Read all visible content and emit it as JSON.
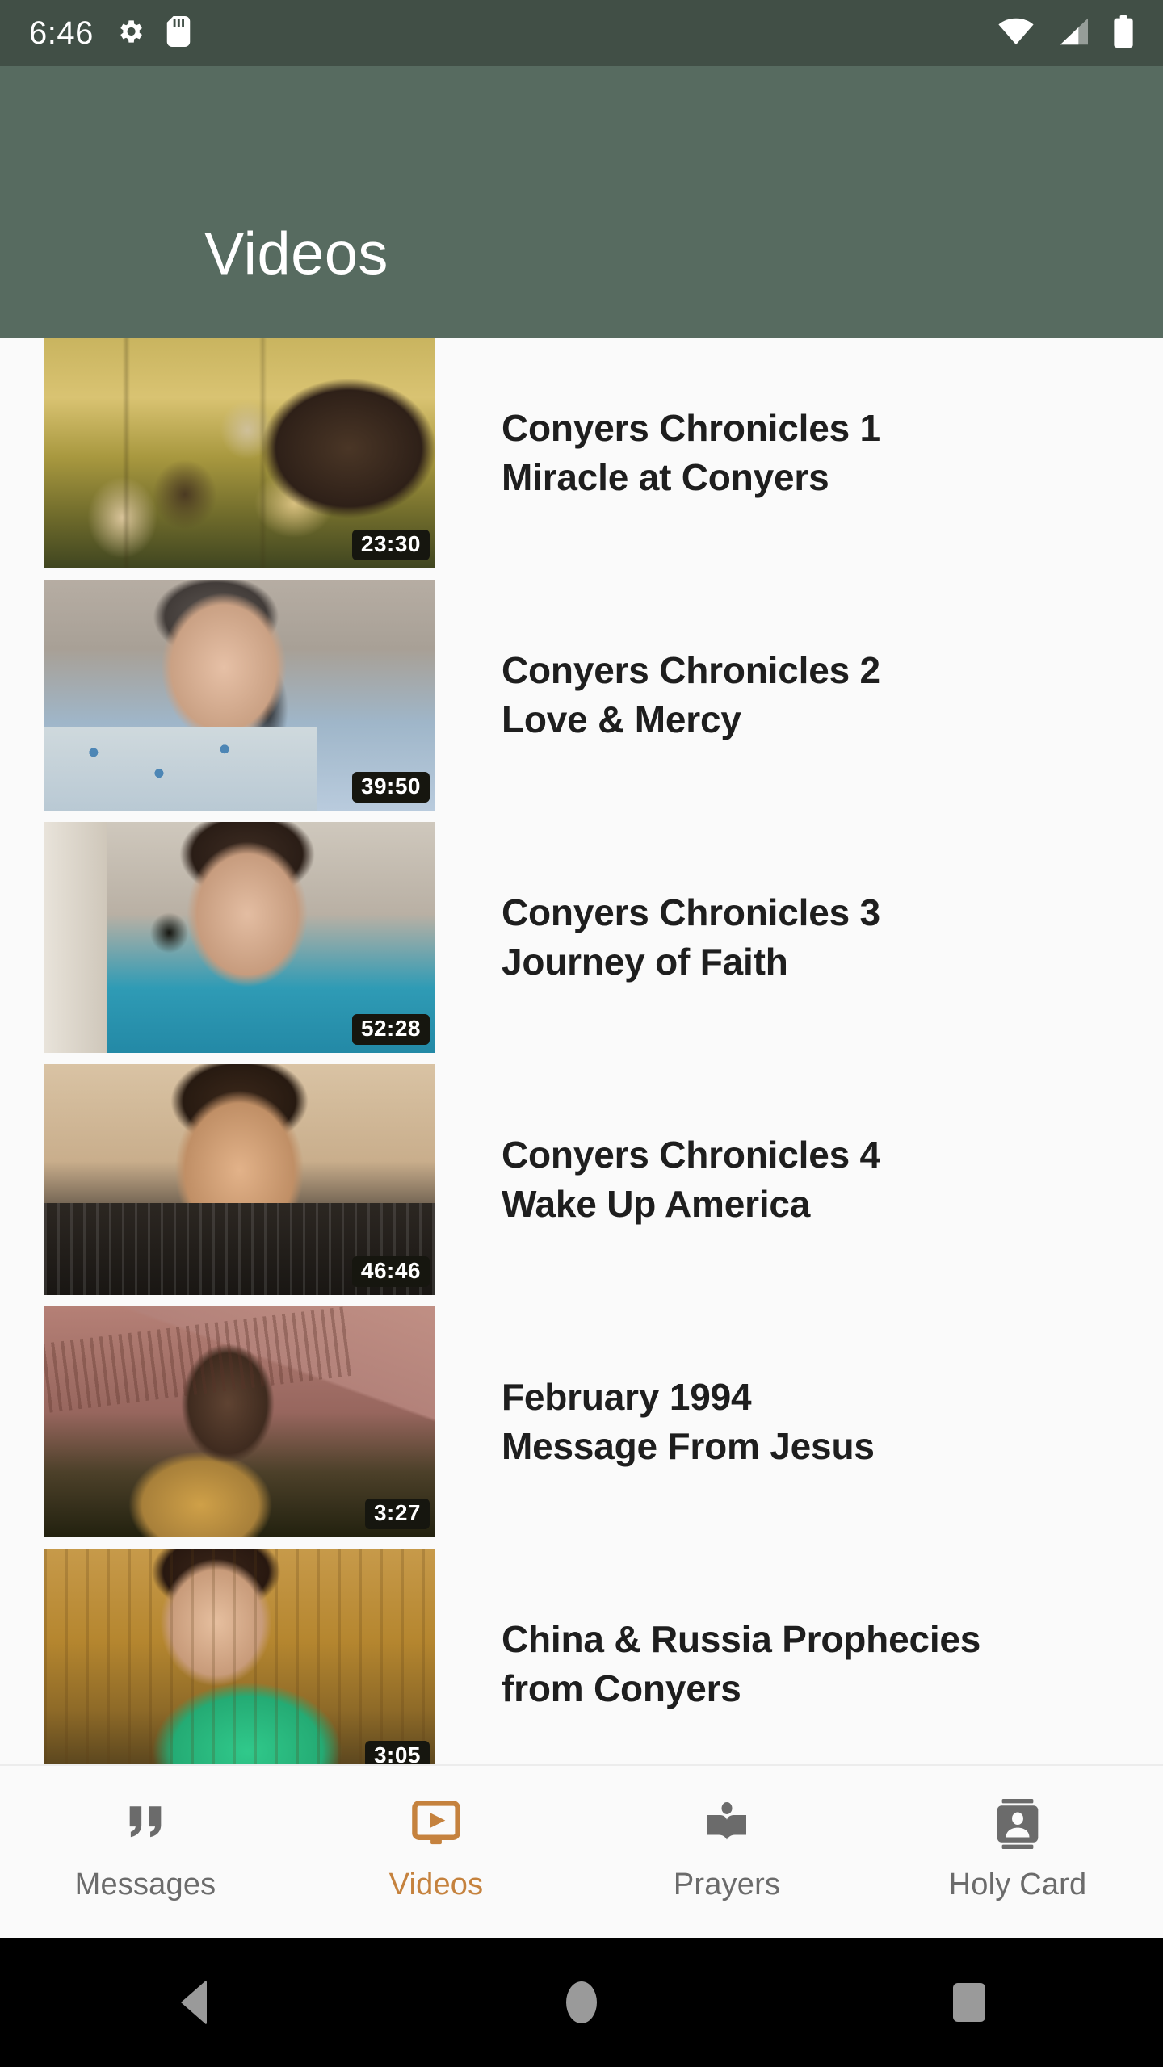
{
  "status_bar": {
    "clock": "6:46",
    "icons": [
      "gear-icon",
      "sd-card-icon"
    ],
    "right_icons": [
      "wifi-icon",
      "cellular-signal-icon",
      "battery-icon"
    ],
    "background_color": "#414F46"
  },
  "app_bar": {
    "title": "Videos",
    "background_color": "#576B60",
    "title_color": "#FFFFFF"
  },
  "videos": [
    {
      "title": "Conyers Chronicles 1\nMiracle at Conyers",
      "duration": "23:30",
      "art": "art-crowd"
    },
    {
      "title": "Conyers Chronicles 2\nLove & Mercy",
      "duration": "39:50",
      "art": "art-mic-blue"
    },
    {
      "title": "Conyers Chronicles 3\nJourney of Faith",
      "duration": "52:28",
      "art": "art-teal"
    },
    {
      "title": "Conyers Chronicles 4\nWake Up America",
      "duration": "46:46",
      "art": "art-brick"
    },
    {
      "title": "February 1994\nMessage From Jesus",
      "duration": "3:27",
      "art": "art-cross"
    },
    {
      "title": "China & Russia Prophecies\nfrom Conyers",
      "duration": "3:05",
      "art": "art-green"
    }
  ],
  "bottom_nav": {
    "active_color": "#C5823E",
    "inactive_color": "#6B6B6B",
    "items": [
      {
        "label": "Messages",
        "icon": "quote-icon",
        "active": false
      },
      {
        "label": "Videos",
        "icon": "video-play-icon",
        "active": true
      },
      {
        "label": "Prayers",
        "icon": "open-book-icon",
        "active": false
      },
      {
        "label": "Holy Card",
        "icon": "contact-card-icon",
        "active": false
      }
    ]
  },
  "android_nav": {
    "buttons": [
      "back-button",
      "home-button",
      "recents-button"
    ],
    "background_color": "#000000"
  }
}
